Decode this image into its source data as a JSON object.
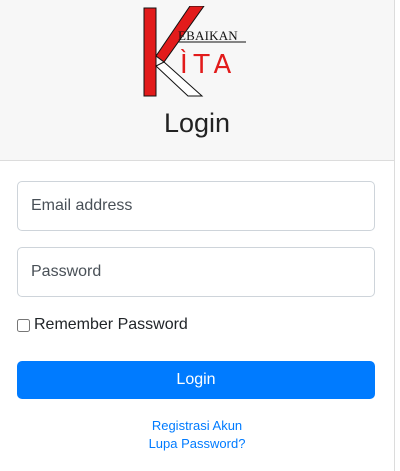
{
  "logo": {
    "letters_top": "EBAIKAN",
    "letters_bottom": "ÌTA",
    "brand_red": "#e21b1b"
  },
  "title": "Login",
  "form": {
    "email_placeholder": "Email address",
    "password_placeholder": "Password",
    "remember_label": "Remember Password",
    "remember_checked": false,
    "login_button": "Login"
  },
  "links": {
    "register": "Registrasi Akun",
    "forgot": "Lupa Password?"
  },
  "colors": {
    "primary": "#007bff",
    "header_bg": "#f7f7f7"
  }
}
